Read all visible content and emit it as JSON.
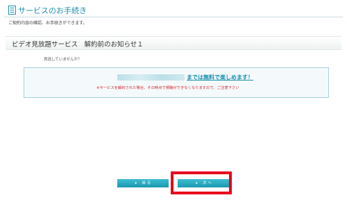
{
  "header": {
    "icon": "document-list-icon",
    "title": "サービスのお手続き"
  },
  "subtitle": "ご契約内容の確認、お手続きができます。",
  "section": {
    "title": "ビデオ見放題サービス　解約前のお知らせ１"
  },
  "question": "見逃していませんか？",
  "notice": {
    "free_link_text": "までは無料で楽しめます！",
    "warning_text": "※サービスを解約された場合、その時点で視聴ができなくなりますので、ご注意下さい"
  },
  "buttons": {
    "arrow_icon": "triangle-right-icon",
    "arrow_glyph": "▸",
    "back_label": "戻 る",
    "next_label": "次 へ"
  },
  "colors": {
    "accent": "#1a8fb0",
    "button": "#2aa9c1",
    "warning": "#d4232a",
    "highlight": "#e8001c"
  }
}
